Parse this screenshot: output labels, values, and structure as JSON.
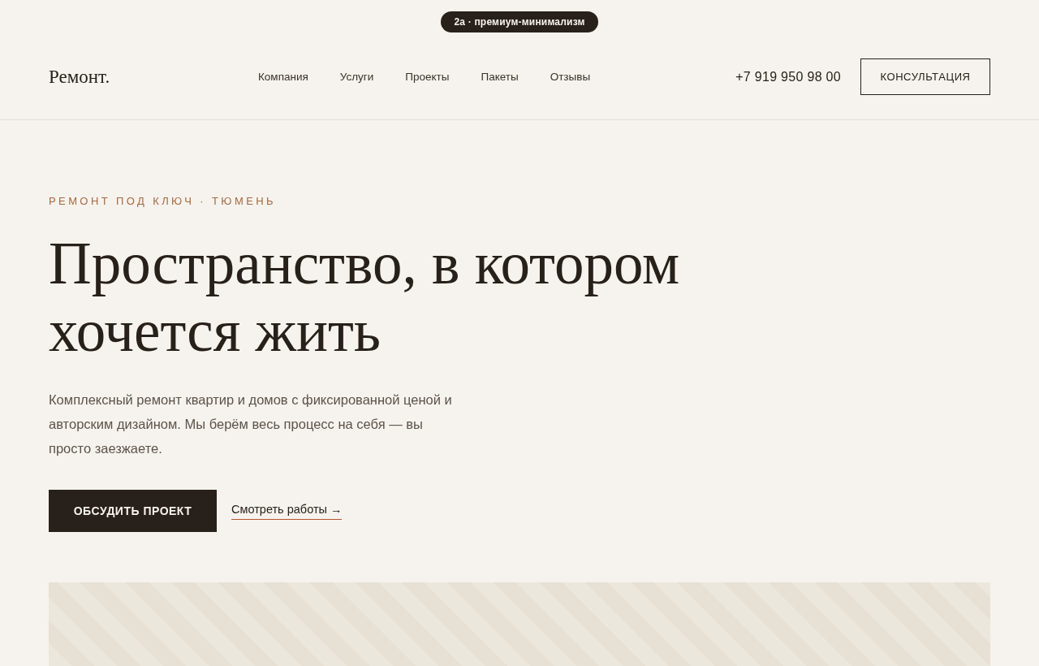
{
  "badge": "2а · премиум-минимализм",
  "header": {
    "logo": "Ремонт.",
    "nav": [
      "Компания",
      "Услуги",
      "Проекты",
      "Пакеты",
      "Отзывы"
    ],
    "phone": "+7 919 950 98 00",
    "cta": "КОНСУЛЬТАЦИЯ"
  },
  "hero": {
    "eyebrow": "РЕМОНТ ПОД КЛЮЧ · ТЮМЕНЬ",
    "title": "Пространство, в котором хочется жить",
    "description": "Комплексный ремонт квартир и домов с фиксированной ценой и авторским дизайном. Мы берём весь процесс на себя — вы просто заезжаете.",
    "primary_button": "ОБСУДИТЬ ПРОЕКТ",
    "link": "Смотреть работы →"
  }
}
